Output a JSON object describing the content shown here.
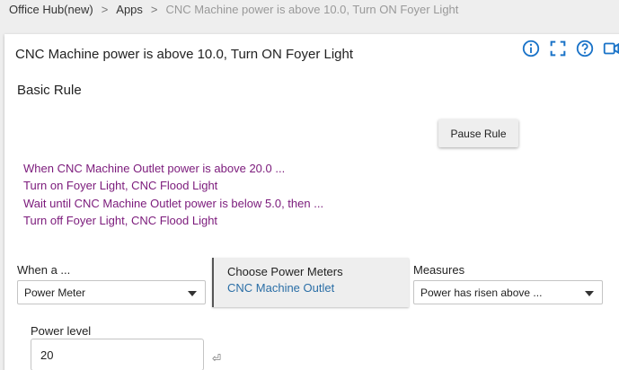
{
  "breadcrumb": {
    "hub": "Office Hub(new)",
    "apps": "Apps",
    "current": "CNC Machine power is above 10.0, Turn ON Foyer Light",
    "sep": ">"
  },
  "header": {
    "title": "CNC Machine power is above 10.0, Turn ON Foyer Light",
    "icons": [
      "info-icon",
      "fullscreen-icon",
      "help-icon",
      "video-icon"
    ]
  },
  "section": {
    "title": "Basic Rule"
  },
  "pause_button": {
    "label": "Pause Rule"
  },
  "description": [
    "When CNC Machine Outlet power is above 20.0 ...",
    "Turn on Foyer Light, CNC  Flood Light",
    "Wait until CNC Machine Outlet power is below 5.0, then ...",
    "Turn off Foyer Light, CNC  Flood Light"
  ],
  "trigger": {
    "label": "When a ...",
    "selected": "Power Meter"
  },
  "chooser": {
    "title": "Choose Power Meters",
    "value": "CNC Machine Outlet"
  },
  "measures": {
    "label": "Measures",
    "selected": "Power has risen above ..."
  },
  "power_level": {
    "label": "Power level",
    "value": "20",
    "enter_glyph": "⏎"
  },
  "colors": {
    "accent": "#1a73c8",
    "description_text": "#7b1a7b",
    "link": "#2a6ea6"
  }
}
